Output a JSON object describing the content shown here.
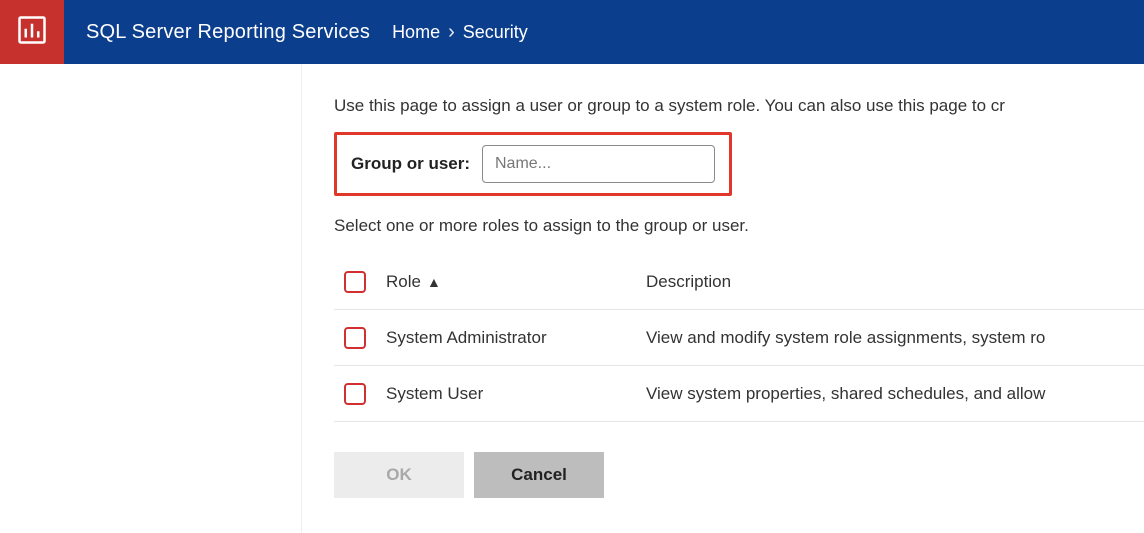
{
  "header": {
    "app_name": "SQL Server Reporting Services",
    "breadcrumb": {
      "home": "Home",
      "current": "Security"
    }
  },
  "main": {
    "intro": "Use this page to assign a user or group to a system role. You can also use this page to cr",
    "group_user_label": "Group or user:",
    "group_user_placeholder": "Name...",
    "select_text": "Select one or more roles to assign to the group or user."
  },
  "table": {
    "role_col": "Role",
    "desc_col": "Description",
    "rows": [
      {
        "role": "System Administrator",
        "desc": "View and modify system role assignments, system ro"
      },
      {
        "role": "System User",
        "desc": "View system properties, shared schedules, and allow "
      }
    ]
  },
  "buttons": {
    "ok": "OK",
    "cancel": "Cancel"
  }
}
